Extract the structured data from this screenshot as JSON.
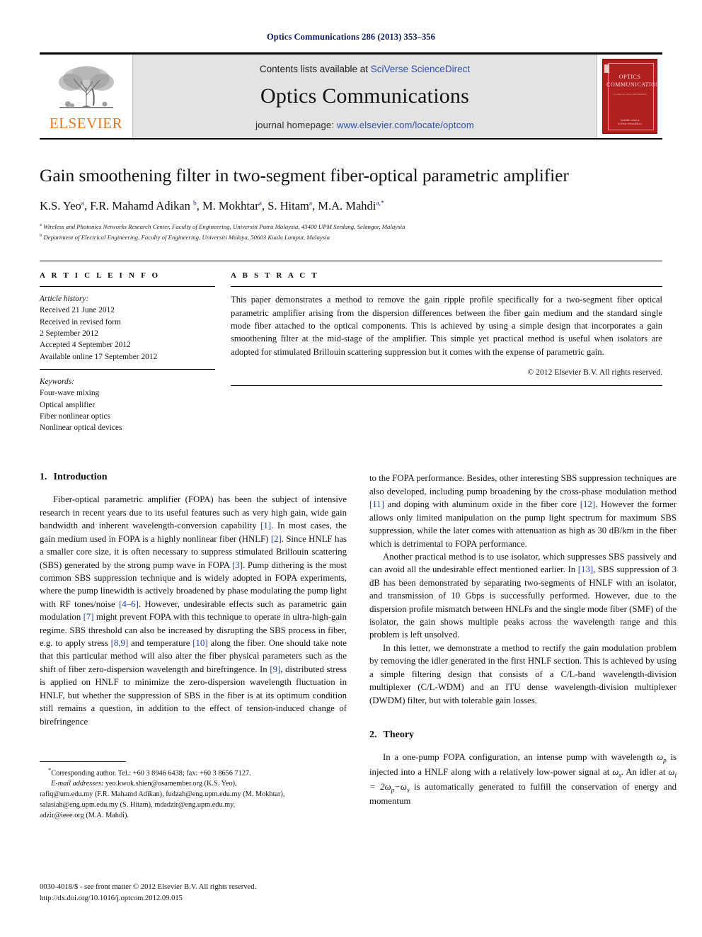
{
  "running_head": "Optics Communications 286 (2013) 353–356",
  "masthead": {
    "logo_word": "ELSEVIER",
    "contents_prefix": "Contents lists available at ",
    "contents_link": "SciVerse ScienceDirect",
    "journal_title": "Optics Communications",
    "homepage_prefix": "journal homepage: ",
    "homepage_url": "www.elsevier.com/locate/optcom",
    "cover": {
      "line1": "OPTICS",
      "line2": "COMMUNICATIONS",
      "subtitle": "a journal on optics and photonics",
      "footer1": "Available online at",
      "footer2": "SciVerse ScienceDirect"
    }
  },
  "article": {
    "title": "Gain smoothening filter in two-segment fiber-optical parametric amplifier",
    "authors": [
      {
        "name": "K.S. Yeo",
        "mark": "a"
      },
      {
        "name": "F.R. Mahamd Adikan",
        "mark": "b"
      },
      {
        "name": "M. Mokhtar",
        "mark": "a"
      },
      {
        "name": "S. Hitam",
        "mark": "a"
      },
      {
        "name": "M.A. Mahdi",
        "mark": "a,*"
      }
    ],
    "affiliations": [
      {
        "mark": "a",
        "text": "Wireless and Photonics Networks Research Center, Faculty of Engineering, Universiti Putra Malaysia, 43400 UPM Serdang, Selangor, Malaysia"
      },
      {
        "mark": "b",
        "text": "Department of Electrical Engineering, Faculty of Engineering, Universiti Malaya, 50603 Kuala Lumpur, Malaysia"
      }
    ]
  },
  "article_info": {
    "heading": "A R T I C L E  I N F O",
    "history_label": "Article history:",
    "history": [
      "Received 21 June 2012",
      "Received in revised form",
      "2 September 2012",
      "Accepted 4 September 2012",
      "Available online 17 September 2012"
    ],
    "keywords_label": "Keywords:",
    "keywords": [
      "Four-wave mixing",
      "Optical amplifier",
      "Fiber nonlinear optics",
      "Nonlinear optical devices"
    ]
  },
  "abstract": {
    "heading": "A B S T R A C T",
    "text": "This paper demonstrates a method to remove the gain ripple profile specifically for a two-segment fiber optical parametric amplifier arising from the dispersion differences between the fiber gain medium and the standard single mode fiber attached to the optical components. This is achieved by using a simple design that incorporates a gain smoothening filter at the mid-stage of the amplifier. This simple yet practical method is useful when isolators are adopted for stimulated Brillouin scattering suppression but it comes with the expense of parametric gain.",
    "copyright": "© 2012 Elsevier B.V. All rights reserved."
  },
  "sections": {
    "introduction": {
      "number": "1.",
      "title": "Introduction",
      "p1_a": "Fiber-optical parametric amplifier (FOPA) has been the subject of intensive research in recent years due to its useful features such as very high gain, wide gain bandwidth and inherent wavelength-conversion capability ",
      "r1": "[1]",
      "p1_b": ". In most cases, the gain medium used in FOPA is a highly nonlinear fiber (HNLF) ",
      "r2": "[2]",
      "p1_c": ". Since HNLF has a smaller core size, it is often necessary to suppress stimulated Brillouin scattering (SBS) generated by the strong pump wave in FOPA ",
      "r3": "[3]",
      "p1_d": ". Pump dithering is the most common SBS suppression technique and is widely adopted in FOPA experiments, where the pump linewidth is actively broadened by phase modulating the pump light with RF tones/noise ",
      "r4": "[4–6]",
      "p1_e": ". However, undesirable effects such as parametric gain modulation ",
      "r5": "[7]",
      "p1_f": " might prevent FOPA with this technique to operate in ultra-high-gain regime. SBS threshold can also be increased by disrupting the SBS process in fiber, e.g. to apply stress ",
      "r6": "[8,9]",
      "p1_g": " and temperature ",
      "r7": "[10]",
      "p1_h": " along the fiber. One should take note that this particular method will also alter the fiber physical parameters such as the shift of fiber zero-dispersion wavelength and birefringence. In ",
      "r8": "[9]",
      "p1_i": ", distributed stress is applied on HNLF to minimize the zero-dispersion wavelength fluctuation in HNLF, but whether the suppression of SBS in the fiber is at its optimum condition still remains a question, in addition to the effect of tension-induced change of birefringence",
      "p2_a": "to the FOPA performance. Besides, other interesting SBS suppression techniques are also developed, including pump broadening by the cross-phase modulation method ",
      "r9": "[11]",
      "p2_b": " and doping with aluminum oxide in the fiber core ",
      "r10": "[12]",
      "p2_c": ". However the former allows only limited manipulation on the pump light spectrum for maximum SBS suppression, while the later comes with attenuation as high as 30 dB/km in the fiber which is detrimental to FOPA performance.",
      "p3_a": "Another practical method is to use isolator, which suppresses SBS passively and can avoid all the undesirable effect mentioned earlier. In ",
      "r11": "[13]",
      "p3_b": ", SBS suppression of 3 dB has been demonstrated by separating two-segments of HNLF with an isolator, and transmission of 10 Gbps is successfully performed. However, due to the dispersion profile mismatch between HNLFs and the single mode fiber (SMF) of the isolator, the gain shows multiple peaks across the wavelength range and this problem is left unsolved.",
      "p4": "In this letter, we demonstrate a method to rectify the gain modulation problem by removing the idler generated in the first HNLF section. This is achieved by using a simple filtering design that consists of a C/L-band wavelength-division multiplexer (C/L-WDM) and an ITU dense wavelength-division multiplexer (DWDM) filter, but with tolerable gain losses."
    },
    "theory": {
      "number": "2.",
      "title": "Theory",
      "p1_a": "In a one-pump FOPA configuration, an intense pump with wavelength ",
      "sym_wp": "ω",
      "sub_p": "p",
      "p1_b": " is injected into a HNLF along with a relatively low-power signal at ",
      "sym_ws": "ω",
      "sub_s": "s",
      "p1_c": ". An idler at ",
      "sym_wi": "ω",
      "sub_i": "i",
      "eq_eq": " = 2",
      "sym_wp2": "ω",
      "sub_p2": "p",
      "eq_minus": "−",
      "sym_ws2": "ω",
      "sub_s2": "s",
      "p1_d": " is automatically generated to fulfill the conservation of energy and momentum"
    }
  },
  "footnote": {
    "marker": "*",
    "corresponding": "Corresponding author. Tel.: +60 3 8946 6438; fax: +60 3 8656 7127.",
    "email_label": "E-mail addresses:",
    "emails_line1": " yeo.kwok.shien@osamember.org (K.S. Yeo),",
    "emails_line2": "rafiq@um.edu.my (F.R. Mahamd Adikan), fudzah@eng.upm.edu.my (M. Mokhtar),",
    "emails_line3": "salasiah@eng.upm.edu.my (S. Hitam), mdadzir@eng.upm.edu.my,",
    "emails_line4": "adzir@ieee.org (M.A. Mahdi)."
  },
  "legal": {
    "line1": "0030-4018/$ - see front matter © 2012 Elsevier B.V. All rights reserved.",
    "line2": "http://dx.doi.org/10.1016/j.optcom.2012.09.015"
  },
  "colors": {
    "running_head": "#0d1a5e",
    "link": "#2a4fae",
    "reference": "#1f3f9e",
    "elsevier_orange": "#e87722",
    "masthead_bg": "#e3e3e3",
    "cover_red": "#b0201f"
  }
}
